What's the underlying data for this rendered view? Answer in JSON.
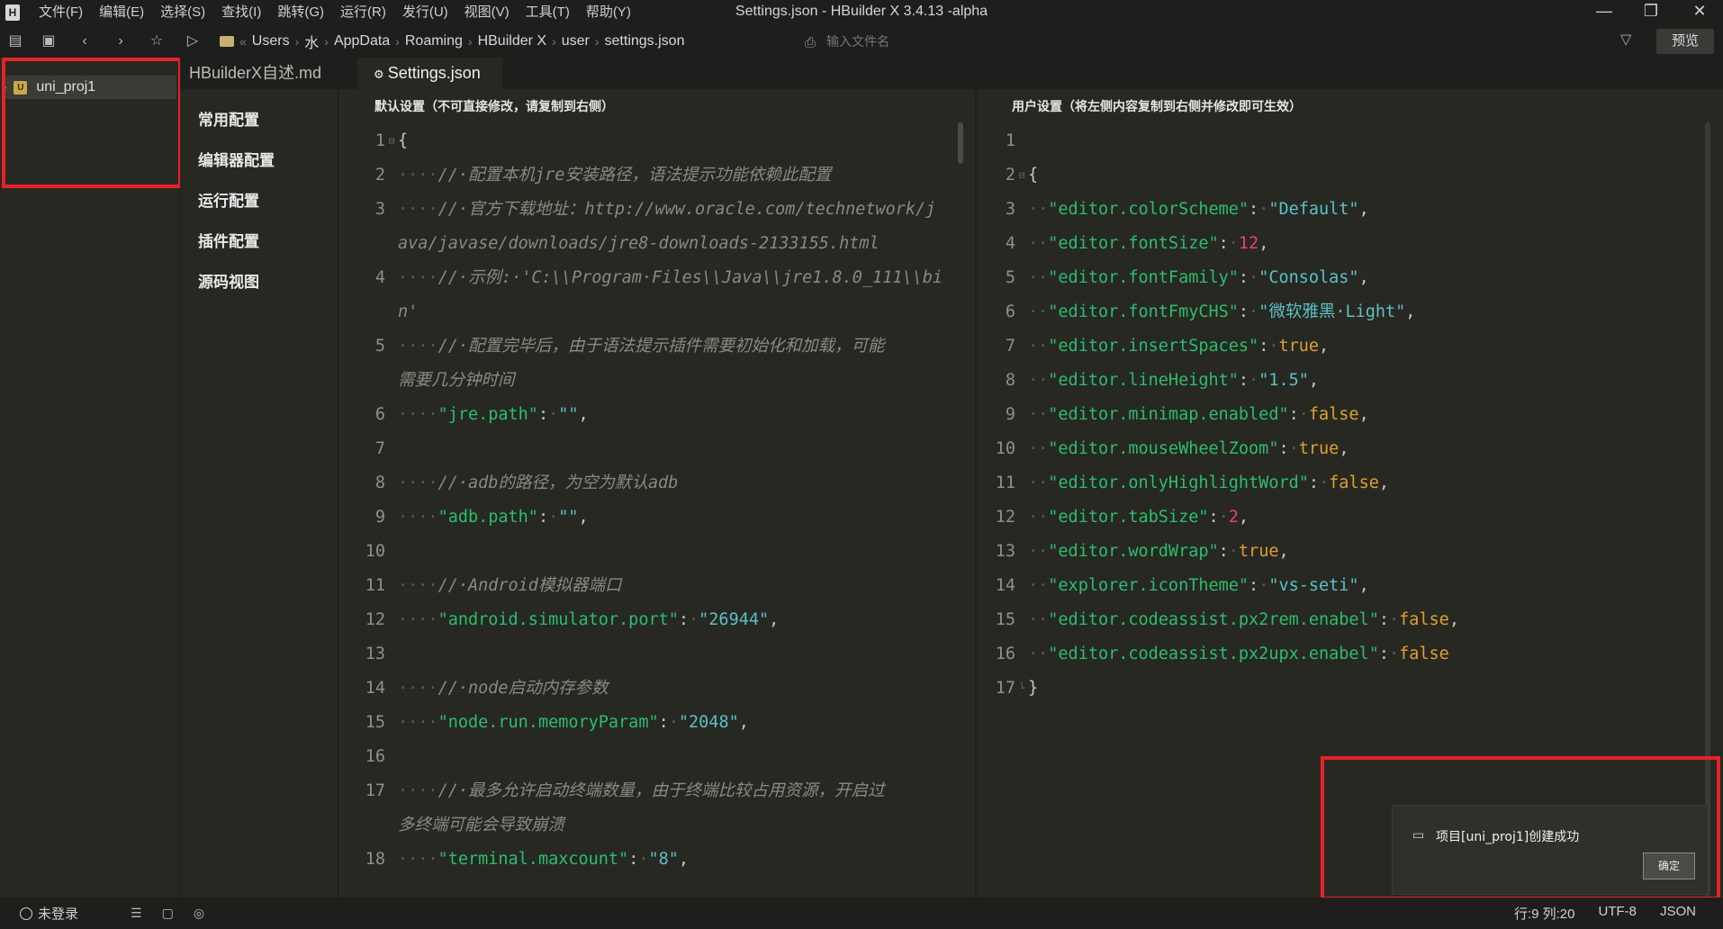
{
  "app": {
    "window_title": "Settings.json - HBuilder X 3.4.13 -alpha",
    "menu": [
      "文件(F)",
      "编辑(E)",
      "选择(S)",
      "查找(I)",
      "跳转(G)",
      "运行(R)",
      "发行(U)",
      "视图(V)",
      "工具(T)",
      "帮助(Y)"
    ]
  },
  "toolbar": {
    "breadcrumb": [
      "Users",
      "水",
      "AppData",
      "Roaming",
      "HBuilder X",
      "user",
      "settings.json"
    ],
    "file_search_placeholder": "输入文件名",
    "preview_label": "预览"
  },
  "project_tree": {
    "project_name": "uni_proj1"
  },
  "tabs": [
    "HBuilderX自述.md",
    "Settings.json"
  ],
  "settings_nav": [
    "常用配置",
    "编辑器配置",
    "运行配置",
    "插件配置",
    "源码视图"
  ],
  "left_pane": {
    "header": "默认设置（不可直接修改，请复制到右侧）",
    "lines": [
      {
        "n": "1",
        "fold": "⊟",
        "parts": [
          [
            "code",
            "{"
          ]
        ]
      },
      {
        "n": "2",
        "parts": [
          [
            "dot",
            "····"
          ],
          [
            "cmt",
            "//·配置本机jre安装路径，语法提示功能依赖此配置"
          ]
        ]
      },
      {
        "n": "3",
        "parts": [
          [
            "dot",
            "····"
          ],
          [
            "cmt",
            "//·官方下载地址：http://www.oracle.com/technetwork/j"
          ]
        ]
      },
      {
        "n": "",
        "parts": [
          [
            "cmt",
            "ava/javase/downloads/jre8-downloads-2133155.html"
          ]
        ]
      },
      {
        "n": "4",
        "parts": [
          [
            "dot",
            "····"
          ],
          [
            "cmt",
            "//·示例:·'C:\\\\Program·Files\\\\Java\\\\jre1.8.0_111\\\\bi"
          ]
        ]
      },
      {
        "n": "",
        "parts": [
          [
            "cmt",
            "n'"
          ]
        ]
      },
      {
        "n": "5",
        "parts": [
          [
            "dot",
            "····"
          ],
          [
            "cmt",
            "//·配置完毕后，由于语法提示插件需要初始化和加载，可能"
          ]
        ]
      },
      {
        "n": "",
        "parts": [
          [
            "cmt",
            "需要几分钟时间"
          ]
        ]
      },
      {
        "n": "6",
        "parts": [
          [
            "dot",
            "····"
          ],
          [
            "key",
            "\"jre.path\""
          ],
          [
            "code",
            ":"
          ],
          [
            "dot",
            "·"
          ],
          [
            "str",
            "\"\""
          ],
          [
            "code",
            ","
          ]
        ]
      },
      {
        "n": "7",
        "parts": []
      },
      {
        "n": "8",
        "parts": [
          [
            "dot",
            "····"
          ],
          [
            "cmt",
            "//·adb的路径，为空为默认adb"
          ]
        ]
      },
      {
        "n": "9",
        "parts": [
          [
            "dot",
            "····"
          ],
          [
            "key",
            "\"adb.path\""
          ],
          [
            "code",
            ":"
          ],
          [
            "dot",
            "·"
          ],
          [
            "str",
            "\"\""
          ],
          [
            "code",
            ","
          ]
        ]
      },
      {
        "n": "10",
        "parts": []
      },
      {
        "n": "11",
        "parts": [
          [
            "dot",
            "····"
          ],
          [
            "cmt",
            "//·Android模拟器端口"
          ]
        ]
      },
      {
        "n": "12",
        "parts": [
          [
            "dot",
            "····"
          ],
          [
            "key",
            "\"android.simulator.port\""
          ],
          [
            "code",
            ":"
          ],
          [
            "dot",
            "·"
          ],
          [
            "str",
            "\"26944\""
          ],
          [
            "code",
            ","
          ]
        ]
      },
      {
        "n": "13",
        "parts": []
      },
      {
        "n": "14",
        "parts": [
          [
            "dot",
            "····"
          ],
          [
            "cmt",
            "//·node启动内存参数"
          ]
        ]
      },
      {
        "n": "15",
        "parts": [
          [
            "dot",
            "····"
          ],
          [
            "key",
            "\"node.run.memoryParam\""
          ],
          [
            "code",
            ":"
          ],
          [
            "dot",
            "·"
          ],
          [
            "str",
            "\"2048\""
          ],
          [
            "code",
            ","
          ]
        ]
      },
      {
        "n": "16",
        "parts": []
      },
      {
        "n": "17",
        "parts": [
          [
            "dot",
            "····"
          ],
          [
            "cmt",
            "//·最多允许启动终端数量，由于终端比较占用资源，开启过"
          ]
        ]
      },
      {
        "n": "",
        "parts": [
          [
            "cmt",
            "多终端可能会导致崩溃"
          ]
        ]
      },
      {
        "n": "18",
        "parts": [
          [
            "dot",
            "····"
          ],
          [
            "key",
            "\"terminal.maxcount\""
          ],
          [
            "code",
            ":"
          ],
          [
            "dot",
            "·"
          ],
          [
            "str",
            "\"8\""
          ],
          [
            "code",
            ","
          ]
        ]
      }
    ]
  },
  "right_pane": {
    "header": "用户设置（将左侧内容复制到右侧并修改即可生效）",
    "lines": [
      {
        "n": "1",
        "parts": []
      },
      {
        "n": "2",
        "fold": "⊟",
        "parts": [
          [
            "code",
            "{"
          ]
        ]
      },
      {
        "n": "3",
        "parts": [
          [
            "dot",
            "··"
          ],
          [
            "key",
            "\"editor.colorScheme\""
          ],
          [
            "code",
            ":"
          ],
          [
            "dot",
            "·"
          ],
          [
            "str",
            "\"Default\""
          ],
          [
            "code",
            ","
          ]
        ]
      },
      {
        "n": "4",
        "parts": [
          [
            "dot",
            "··"
          ],
          [
            "key",
            "\"editor.fontSize\""
          ],
          [
            "code",
            ":"
          ],
          [
            "dot",
            "·"
          ],
          [
            "num",
            "12"
          ],
          [
            "code",
            ","
          ]
        ]
      },
      {
        "n": "5",
        "parts": [
          [
            "dot",
            "··"
          ],
          [
            "key",
            "\"editor.fontFamily\""
          ],
          [
            "code",
            ":"
          ],
          [
            "dot",
            "·"
          ],
          [
            "str",
            "\"Consolas\""
          ],
          [
            "code",
            ","
          ]
        ]
      },
      {
        "n": "6",
        "parts": [
          [
            "dot",
            "··"
          ],
          [
            "key",
            "\"editor.fontFmyCHS\""
          ],
          [
            "code",
            ":"
          ],
          [
            "dot",
            "·"
          ],
          [
            "str",
            "\"微软雅黑·Light\""
          ],
          [
            "code",
            ","
          ]
        ]
      },
      {
        "n": "7",
        "parts": [
          [
            "dot",
            "··"
          ],
          [
            "key",
            "\"editor.insertSpaces\""
          ],
          [
            "code",
            ":"
          ],
          [
            "dot",
            "·"
          ],
          [
            "kw",
            "true"
          ],
          [
            "code",
            ","
          ]
        ]
      },
      {
        "n": "8",
        "parts": [
          [
            "dot",
            "··"
          ],
          [
            "key",
            "\"editor.lineHeight\""
          ],
          [
            "code",
            ":"
          ],
          [
            "dot",
            "·"
          ],
          [
            "str",
            "\"1.5\""
          ],
          [
            "code",
            ","
          ]
        ]
      },
      {
        "n": "9",
        "parts": [
          [
            "dot",
            "··"
          ],
          [
            "key",
            "\"editor.minimap.enabled\""
          ],
          [
            "code",
            ":"
          ],
          [
            "dot",
            "·"
          ],
          [
            "kw",
            "false"
          ],
          [
            "code",
            ","
          ]
        ]
      },
      {
        "n": "10",
        "parts": [
          [
            "dot",
            "··"
          ],
          [
            "key",
            "\"editor.mouseWheelZoom\""
          ],
          [
            "code",
            ":"
          ],
          [
            "dot",
            "·"
          ],
          [
            "kw",
            "true"
          ],
          [
            "code",
            ","
          ]
        ]
      },
      {
        "n": "11",
        "parts": [
          [
            "dot",
            "··"
          ],
          [
            "key",
            "\"editor.onlyHighlightWord\""
          ],
          [
            "code",
            ":"
          ],
          [
            "dot",
            "·"
          ],
          [
            "kw",
            "false"
          ],
          [
            "code",
            ","
          ]
        ]
      },
      {
        "n": "12",
        "parts": [
          [
            "dot",
            "··"
          ],
          [
            "key",
            "\"editor.tabSize\""
          ],
          [
            "code",
            ":"
          ],
          [
            "dot",
            "·"
          ],
          [
            "num",
            "2"
          ],
          [
            "code",
            ","
          ]
        ]
      },
      {
        "n": "13",
        "parts": [
          [
            "dot",
            "··"
          ],
          [
            "key",
            "\"editor.wordWrap\""
          ],
          [
            "code",
            ":"
          ],
          [
            "dot",
            "·"
          ],
          [
            "kw",
            "true"
          ],
          [
            "code",
            ","
          ]
        ]
      },
      {
        "n": "14",
        "parts": [
          [
            "dot",
            "··"
          ],
          [
            "key",
            "\"explorer.iconTheme\""
          ],
          [
            "code",
            ":"
          ],
          [
            "dot",
            "·"
          ],
          [
            "str",
            "\"vs-seti\""
          ],
          [
            "code",
            ","
          ]
        ]
      },
      {
        "n": "15",
        "parts": [
          [
            "dot",
            "··"
          ],
          [
            "key",
            "\"editor.codeassist.px2rem.enabel\""
          ],
          [
            "code",
            ":"
          ],
          [
            "dot",
            "·"
          ],
          [
            "kw",
            "false"
          ],
          [
            "code",
            ","
          ]
        ]
      },
      {
        "n": "16",
        "parts": [
          [
            "dot",
            "··"
          ],
          [
            "key",
            "\"editor.codeassist.px2upx.enabel\""
          ],
          [
            "code",
            ":"
          ],
          [
            "dot",
            "·"
          ],
          [
            "kw",
            "false"
          ]
        ]
      },
      {
        "n": "17",
        "fold": "└",
        "parts": [
          [
            "code",
            "}"
          ]
        ]
      }
    ]
  },
  "notification": {
    "message": "项目[uni_proj1]创建成功",
    "button": "确定"
  },
  "statusbar": {
    "login": "未登录",
    "cursor": "行:9  列:20",
    "encoding": "UTF-8",
    "language": "JSON"
  },
  "colors": {
    "highlight_box": "#e6212a",
    "editor_bg": "#272822"
  }
}
